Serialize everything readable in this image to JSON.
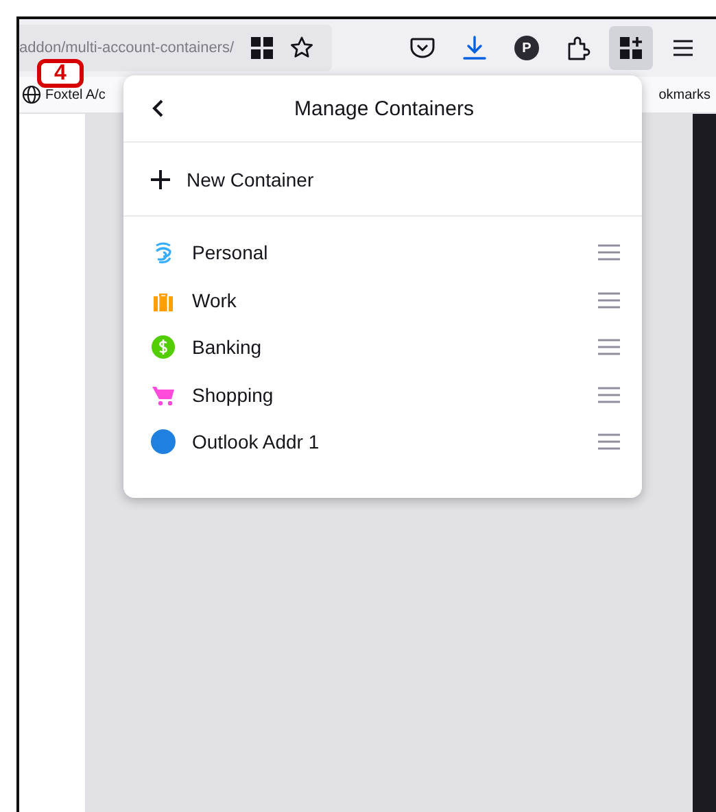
{
  "toolbar": {
    "url": "addon/multi-account-containers/",
    "profile_initial": "P",
    "containers_button_selected": true
  },
  "step_badge": "4",
  "bookmarks": {
    "left": "Foxtel A/c",
    "right": "okmarks"
  },
  "panel": {
    "title": "Manage Containers",
    "new_container": "New Container",
    "containers": [
      {
        "name": "Personal",
        "kind": "fingerprint",
        "color": "#37adff"
      },
      {
        "name": "Work",
        "kind": "briefcase",
        "color": "#ff9f00"
      },
      {
        "name": "Banking",
        "kind": "dollar",
        "color": "#51cd00"
      },
      {
        "name": "Shopping",
        "kind": "cart",
        "color": "#ff4bda"
      },
      {
        "name": "Outlook Addr 1",
        "kind": "circle",
        "color": "#1f80e0"
      }
    ]
  }
}
